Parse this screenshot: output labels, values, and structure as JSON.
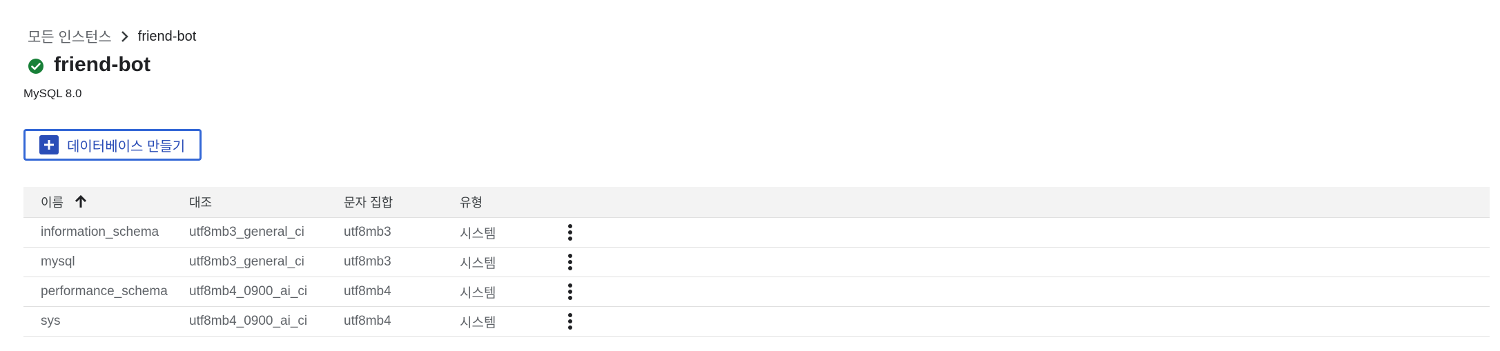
{
  "breadcrumb": {
    "parent": "모든 인스턴스",
    "current": "friend-bot"
  },
  "instance": {
    "name": "friend-bot",
    "version": "MySQL 8.0",
    "status_icon": "check-circle-icon",
    "status_color": "#188038"
  },
  "actions": {
    "create_database_label": "데이터베이스 만들기"
  },
  "table": {
    "headers": {
      "name": "이름",
      "collation": "대조",
      "charset": "문자 집합",
      "type": "유형"
    },
    "rows": [
      {
        "name": "information_schema",
        "collation": "utf8mb3_general_ci",
        "charset": "utf8mb3",
        "type": "시스템"
      },
      {
        "name": "mysql",
        "collation": "utf8mb3_general_ci",
        "charset": "utf8mb3",
        "type": "시스템"
      },
      {
        "name": "performance_schema",
        "collation": "utf8mb4_0900_ai_ci",
        "charset": "utf8mb4",
        "type": "시스템"
      },
      {
        "name": "sys",
        "collation": "utf8mb4_0900_ai_ci",
        "charset": "utf8mb4",
        "type": "시스템"
      }
    ]
  },
  "colors": {
    "accent": "#2a4db7",
    "button_border": "#3367d6",
    "header_bg": "#f3f3f3"
  }
}
